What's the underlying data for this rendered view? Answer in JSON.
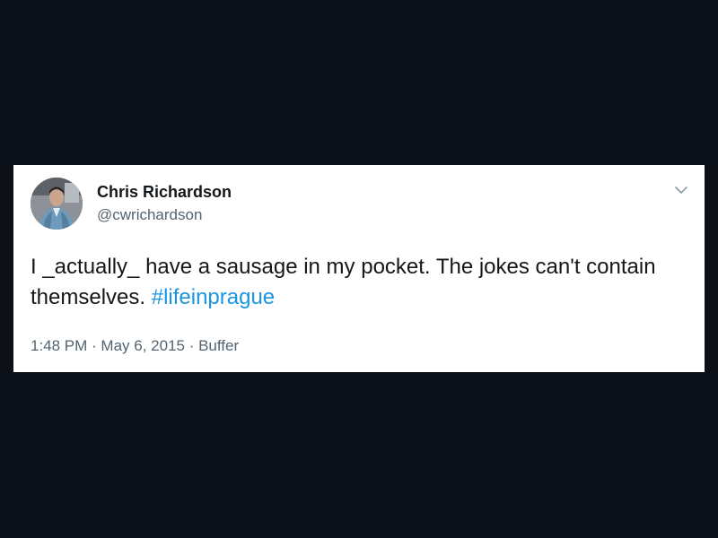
{
  "tweet": {
    "author_name": "Chris Richardson",
    "author_handle": "@cwrichardson",
    "text_main": "I _actually_ have a sausage in my pocket. The jokes can't contain themselves. ",
    "hashtag": "#lifeinprague",
    "time": "1:48 PM",
    "separator": " · ",
    "date": "May 6, 2015",
    "source": "Buffer"
  },
  "colors": {
    "background": "#0b1018",
    "card": "#ffffff",
    "text": "#14171a",
    "secondary": "#536471",
    "link": "#1b95e0"
  },
  "icons": {
    "more": "chevron-down-icon",
    "avatar": "profile-photo"
  }
}
